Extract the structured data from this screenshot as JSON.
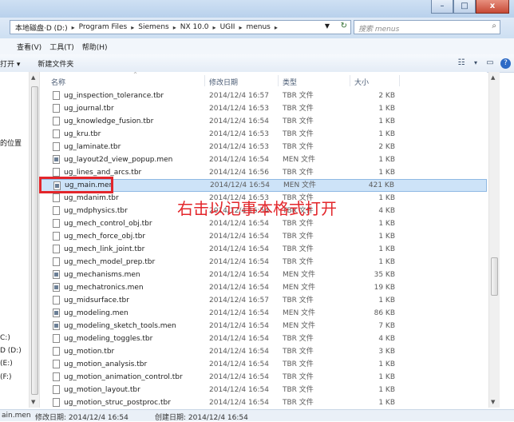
{
  "window": {
    "minimize": "–",
    "maximize": "□",
    "close": "x"
  },
  "address": {
    "crumbs": [
      "本地磁盘·D (D:)",
      "Program Files",
      "Siemens",
      "NX 10.0",
      "UGII",
      "menus"
    ],
    "search_placeholder": "搜索 menus"
  },
  "menu": [
    "查看(V)",
    "工具(T)",
    "帮助(H)"
  ],
  "toolbar": {
    "open": "打开 ▾",
    "new_folder": "新建文件夹"
  },
  "nav": {
    "location": "的位置",
    "drive_c": "C:)",
    "drive_d": "D (D:)",
    "drive_e": "(E:)",
    "drive_f": "(F:)"
  },
  "columns": {
    "name": "名称",
    "date": "修改日期",
    "type": "类型",
    "size": "大小"
  },
  "files": [
    {
      "name": "ug_inspection_tolerance.tbr",
      "date": "2014/12/4 16:57",
      "type": "TBR 文件",
      "size": "2 KB",
      "kind": "tbr"
    },
    {
      "name": "ug_journal.tbr",
      "date": "2014/12/4 16:53",
      "type": "TBR 文件",
      "size": "1 KB",
      "kind": "tbr"
    },
    {
      "name": "ug_knowledge_fusion.tbr",
      "date": "2014/12/4 16:54",
      "type": "TBR 文件",
      "size": "1 KB",
      "kind": "tbr"
    },
    {
      "name": "ug_kru.tbr",
      "date": "2014/12/4 16:53",
      "type": "TBR 文件",
      "size": "1 KB",
      "kind": "tbr"
    },
    {
      "name": "ug_laminate.tbr",
      "date": "2014/12/4 16:53",
      "type": "TBR 文件",
      "size": "2 KB",
      "kind": "tbr"
    },
    {
      "name": "ug_layout2d_view_popup.men",
      "date": "2014/12/4 16:54",
      "type": "MEN 文件",
      "size": "1 KB",
      "kind": "men"
    },
    {
      "name": "ug_lines_and_arcs.tbr",
      "date": "2014/12/4 16:56",
      "type": "TBR 文件",
      "size": "1 KB",
      "kind": "tbr"
    },
    {
      "name": "ug_main.men",
      "date": "2014/12/4 16:54",
      "type": "MEN 文件",
      "size": "421 KB",
      "kind": "men",
      "selected": true
    },
    {
      "name": "ug_mdanim.tbr",
      "date": "2014/12/4 16:53",
      "type": "TBR 文件",
      "size": "1 KB",
      "kind": "tbr"
    },
    {
      "name": "ug_mdphysics.tbr",
      "date": "2014/12/4 16:54",
      "type": "TBR 文件",
      "size": "4 KB",
      "kind": "tbr"
    },
    {
      "name": "ug_mech_control_obj.tbr",
      "date": "2014/12/4 16:54",
      "type": "TBR 文件",
      "size": "1 KB",
      "kind": "tbr"
    },
    {
      "name": "ug_mech_force_obj.tbr",
      "date": "2014/12/4 16:54",
      "type": "TBR 文件",
      "size": "1 KB",
      "kind": "tbr"
    },
    {
      "name": "ug_mech_link_joint.tbr",
      "date": "2014/12/4 16:54",
      "type": "TBR 文件",
      "size": "1 KB",
      "kind": "tbr"
    },
    {
      "name": "ug_mech_model_prep.tbr",
      "date": "2014/12/4 16:54",
      "type": "TBR 文件",
      "size": "1 KB",
      "kind": "tbr"
    },
    {
      "name": "ug_mechanisms.men",
      "date": "2014/12/4 16:54",
      "type": "MEN 文件",
      "size": "35 KB",
      "kind": "men"
    },
    {
      "name": "ug_mechatronics.men",
      "date": "2014/12/4 16:54",
      "type": "MEN 文件",
      "size": "19 KB",
      "kind": "men"
    },
    {
      "name": "ug_midsurface.tbr",
      "date": "2014/12/4 16:57",
      "type": "TBR 文件",
      "size": "1 KB",
      "kind": "tbr"
    },
    {
      "name": "ug_modeling.men",
      "date": "2014/12/4 16:54",
      "type": "MEN 文件",
      "size": "86 KB",
      "kind": "men"
    },
    {
      "name": "ug_modeling_sketch_tools.men",
      "date": "2014/12/4 16:54",
      "type": "MEN 文件",
      "size": "7 KB",
      "kind": "men"
    },
    {
      "name": "ug_modeling_toggles.tbr",
      "date": "2014/12/4 16:54",
      "type": "TBR 文件",
      "size": "4 KB",
      "kind": "tbr"
    },
    {
      "name": "ug_motion.tbr",
      "date": "2014/12/4 16:54",
      "type": "TBR 文件",
      "size": "3 KB",
      "kind": "tbr"
    },
    {
      "name": "ug_motion_analysis.tbr",
      "date": "2014/12/4 16:54",
      "type": "TBR 文件",
      "size": "1 KB",
      "kind": "tbr"
    },
    {
      "name": "ug_motion_animation_control.tbr",
      "date": "2014/12/4 16:54",
      "type": "TBR 文件",
      "size": "1 KB",
      "kind": "tbr"
    },
    {
      "name": "ug_motion_layout.tbr",
      "date": "2014/12/4 16:54",
      "type": "TBR 文件",
      "size": "1 KB",
      "kind": "tbr"
    },
    {
      "name": "ug_motion_struc_postproc.tbr",
      "date": "2014/12/4 16:54",
      "type": "TBR 文件",
      "size": "1 KB",
      "kind": "tbr"
    }
  ],
  "annotation": "右击以记事本格式打开",
  "status": {
    "name": "ain.men",
    "modified": "修改日期: 2014/12/4 16:54",
    "created": "创建日期: 2014/12/4 16:54"
  }
}
